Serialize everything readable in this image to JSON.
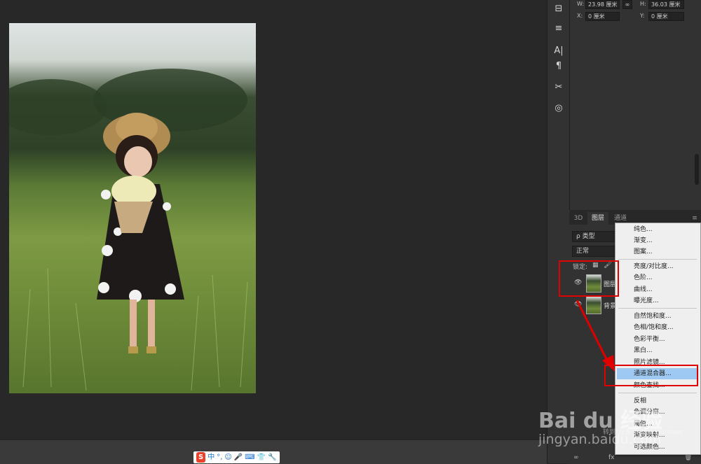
{
  "properties": {
    "w_label": "W:",
    "w_value": "23.98 厘米",
    "h_label": "H:",
    "h_value": "36.03 厘米",
    "x_label": "X:",
    "x_value": "0 厘米",
    "y_label": "Y:",
    "y_value": "0 厘米"
  },
  "layers_panel": {
    "tabs": [
      "3D",
      "图层",
      "通道"
    ],
    "filter_label": "ρ 类型",
    "blend_mode": "正常",
    "lock_label": "锁定:",
    "layers": [
      {
        "name": "图层"
      },
      {
        "name": "背景"
      }
    ]
  },
  "adjustment_menu": {
    "items": [
      "纯色...",
      "渐变...",
      "图案...",
      "亮度/对比度...",
      "色阶...",
      "曲线...",
      "曝光度...",
      "自然饱和度...",
      "色相/饱和度...",
      "色彩平衡...",
      "黑白...",
      "照片滤镜...",
      "通道混合器...",
      "颜色查找...",
      "反相",
      "色调分离...",
      "阈值...",
      "渐变映射...",
      "可选颜色..."
    ],
    "highlighted": "通道混合器..."
  },
  "ime_toolbar": {
    "items": [
      "S",
      "中",
      "°,",
      "☺",
      "🎤",
      "⌨",
      "👕",
      "🔧"
    ]
  },
  "watermark": {
    "line1": "Bai du 经验",
    "line2": "jingyan.baidu.com",
    "os_notice": "转到\"设置\"以激活 Windows"
  },
  "colors": {
    "annotation_red": "#e00000",
    "menu_highlight": "#9ec9f2"
  }
}
